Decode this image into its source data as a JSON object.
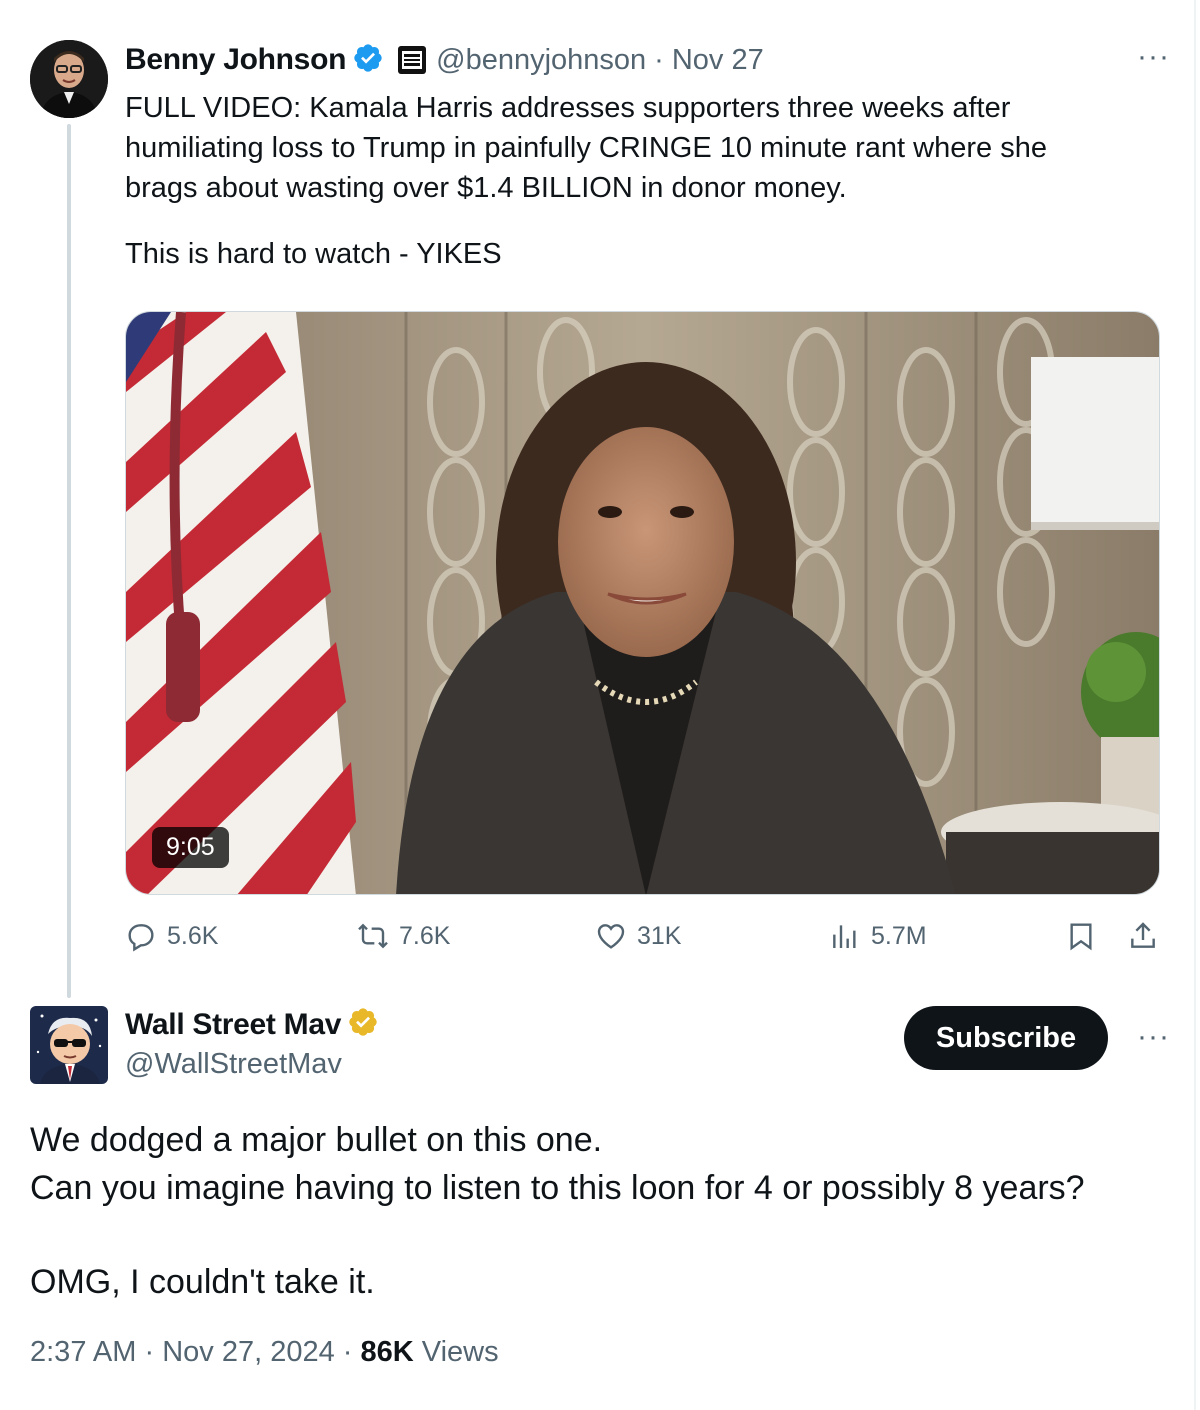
{
  "parent_tweet": {
    "author_name": "Benny Johnson",
    "handle": "@bennyjohnson",
    "separator": "·",
    "date": "Nov 27",
    "more_label": "···",
    "text_lines": [
      "FULL VIDEO: Kamala Harris addresses supporters three weeks after",
      "humiliating loss to Trump in painfully CRINGE 10 minute rant where she",
      "brags about wasting over $1.4 BILLION in donor money."
    ],
    "text_second": "This is hard to watch - YIKES",
    "video": {
      "duration": "9:05"
    },
    "metrics": {
      "replies": "5.6K",
      "reposts": "7.6K",
      "likes": "31K",
      "views": "5.7M"
    }
  },
  "reply_tweet": {
    "author_name": "Wall Street Mav",
    "handle": "@WallStreetMav",
    "subscribe_label": "Subscribe",
    "more_label": "···",
    "text_lines": [
      "We dodged a major bullet on this one.",
      "Can you imagine having to listen to this loon for 4 or possibly 8 years?"
    ],
    "text_second": "OMG, I couldn't take it.",
    "time": "2:37 AM",
    "separator": "·",
    "date": "Nov 27, 2024",
    "views_count": "86K",
    "views_label": "Views"
  },
  "colors": {
    "text_primary": "#0f1419",
    "text_secondary": "#536471",
    "verified_blue": "#1d9bf0",
    "verified_gold": "#e8b829",
    "thread_line": "#cfd9de"
  },
  "icons": [
    "verified-blue-icon",
    "affiliate-badge-icon",
    "reply-icon",
    "repost-icon",
    "like-icon",
    "views-icon",
    "bookmark-icon",
    "share-icon",
    "verified-gold-icon"
  ]
}
